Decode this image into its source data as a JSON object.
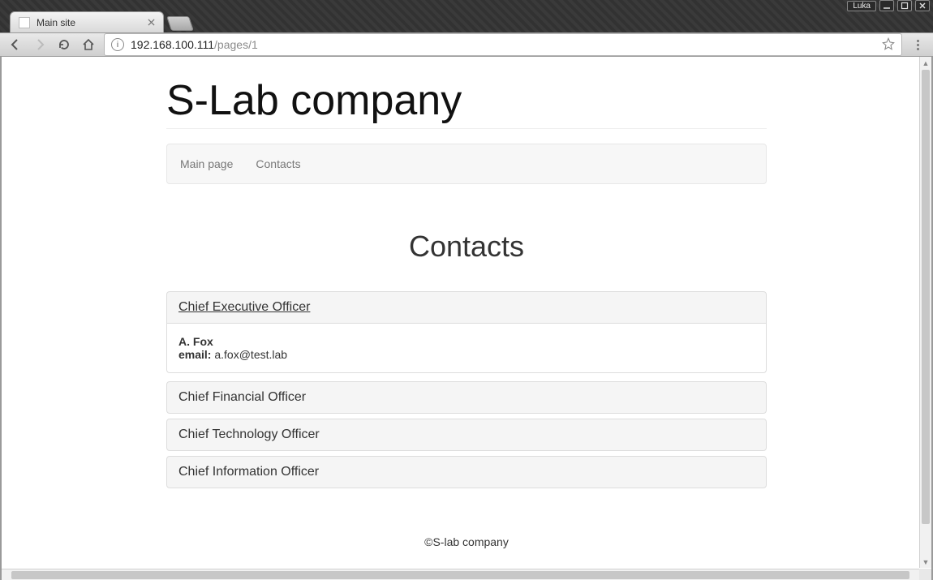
{
  "window": {
    "user_label": "Luka"
  },
  "tab": {
    "title": "Main site"
  },
  "address": {
    "host": "192.168.100.111",
    "path": "/pages/1"
  },
  "site": {
    "title": "S-Lab company"
  },
  "nav": {
    "items": [
      {
        "label": "Main page"
      },
      {
        "label": "Contacts"
      }
    ]
  },
  "page": {
    "heading": "Contacts"
  },
  "contacts": [
    {
      "role": "Chief Executive Officer",
      "expanded": true,
      "name": "A. Fox",
      "email_label": "email:",
      "email": "a.fox@test.lab"
    },
    {
      "role": "Chief Financial Officer",
      "expanded": false
    },
    {
      "role": "Chief Technology Officer",
      "expanded": false
    },
    {
      "role": "Chief Information Officer",
      "expanded": false
    }
  ],
  "footer": {
    "text": "©S-lab company"
  }
}
